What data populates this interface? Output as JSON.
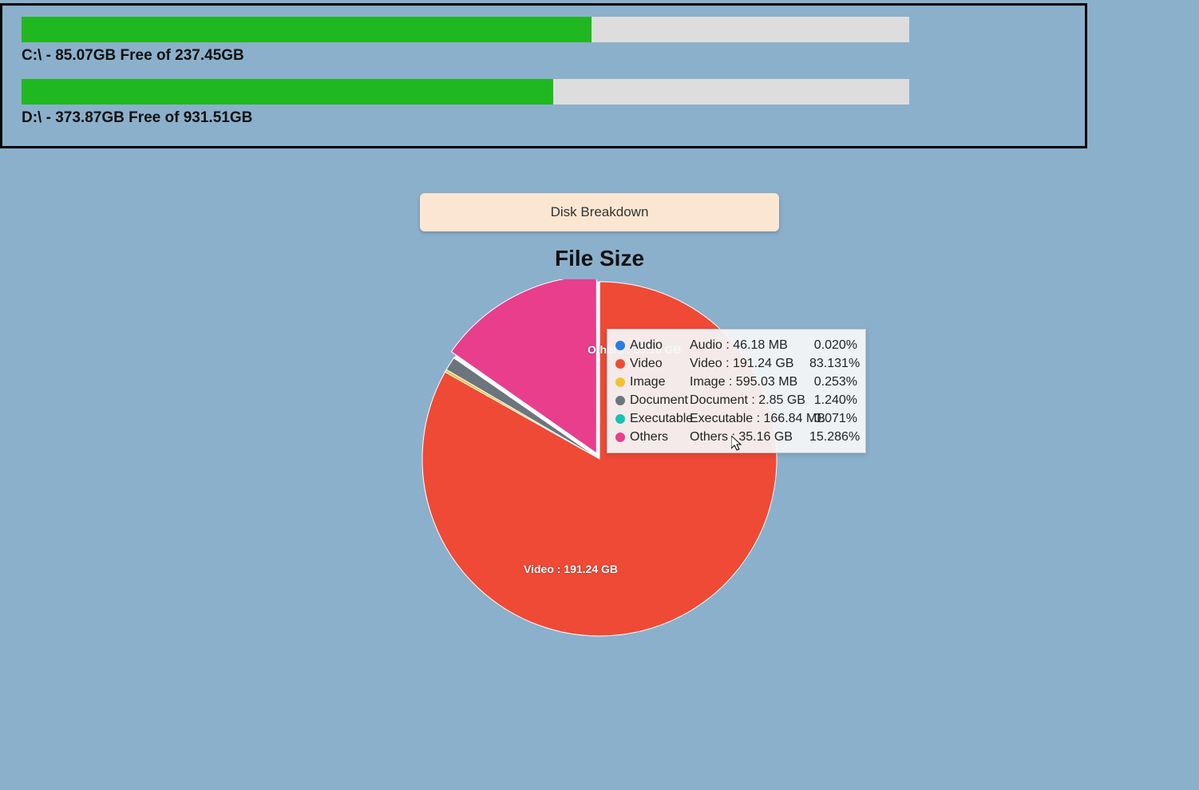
{
  "drives": [
    {
      "label": "C:\\ - 85.07GB Free of 237.45GB",
      "used_gb": 152.38,
      "total_gb": 237.45
    },
    {
      "label": "D:\\ - 373.87GB Free of 931.51GB",
      "used_gb": 557.64,
      "total_gb": 931.51
    }
  ],
  "tab_label": "Disk Breakdown",
  "chart_title": "File Size",
  "chart_data": {
    "type": "pie",
    "title": "File Size",
    "series": [
      {
        "name": "Audio",
        "size_label": "Audio  :  46.18 MB",
        "percent": 0.02,
        "color": "#2a7de1"
      },
      {
        "name": "Video",
        "size_label": "Video  :  191.24 GB",
        "percent": 83.131,
        "color": "#ef4a36"
      },
      {
        "name": "Image",
        "size_label": "Image  :  595.03 MB",
        "percent": 0.253,
        "color": "#f1c232"
      },
      {
        "name": "Document",
        "size_label": "Document  :  2.85 GB",
        "percent": 1.24,
        "color": "#6c757d"
      },
      {
        "name": "Executable",
        "size_label": "Executable  :  166.84 MB",
        "percent": 0.071,
        "color": "#17c3b2"
      },
      {
        "name": "Others",
        "size_label": "Others  :  35.16 GB",
        "percent": 15.286,
        "color": "#e83e8c"
      }
    ]
  },
  "slice_labels": {
    "others": "Others  :  35.16 GB",
    "video": "Video  :  191.24 GB"
  },
  "pct_fmt": {
    "Audio": "0.020%",
    "Video": "83.131%",
    "Image": "0.253%",
    "Document": "1.240%",
    "Executable": "0.071%",
    "Others": "15.286%"
  }
}
